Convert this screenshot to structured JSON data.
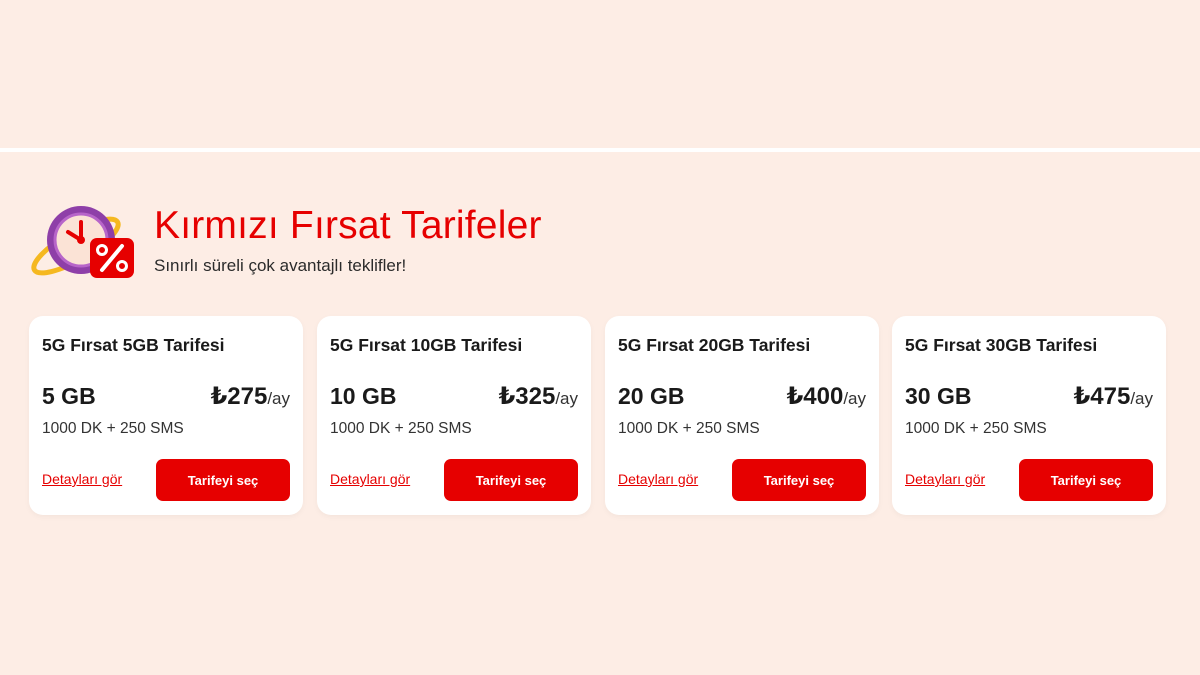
{
  "section": {
    "title": "Kırmızı Fırsat Tarifeler",
    "subtitle": "Sınırlı süreli çok avantajlı teklifler!",
    "icon": "clock-discount-icon"
  },
  "colors": {
    "accent": "#e60000",
    "background": "#fdede5",
    "card": "#ffffff"
  },
  "plans": [
    {
      "name": "5G Fırsat 5GB Tarifesi",
      "data": "5 GB",
      "price": "₺275",
      "unit": "/ay",
      "minutes": "1000 DK + 250 SMS",
      "details": "Detayları gör",
      "cta": "Tarifeyi seç"
    },
    {
      "name": "5G Fırsat 10GB Tarifesi",
      "data": "10 GB",
      "price": "₺325",
      "unit": "/ay",
      "minutes": "1000 DK + 250 SMS",
      "details": "Detayları gör",
      "cta": "Tarifeyi seç"
    },
    {
      "name": "5G Fırsat 20GB Tarifesi",
      "data": "20 GB",
      "price": "₺400",
      "unit": "/ay",
      "minutes": "1000 DK + 250 SMS",
      "details": "Detayları gör",
      "cta": "Tarifeyi seç"
    },
    {
      "name": "5G Fırsat 30GB Tarifesi",
      "data": "30 GB",
      "price": "₺475",
      "unit": "/ay",
      "minutes": "1000 DK + 250 SMS",
      "details": "Detayları gör",
      "cta": "Tarifeyi seç"
    }
  ]
}
